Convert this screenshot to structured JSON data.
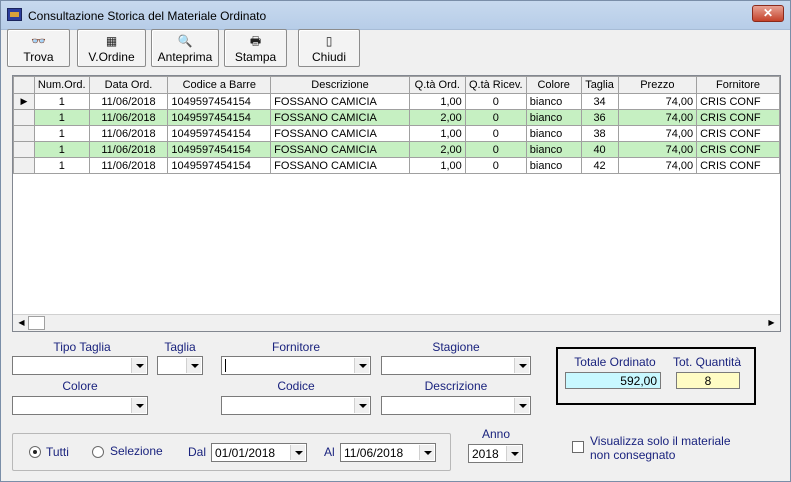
{
  "window": {
    "title": "Consultazione Storica del Materiale Ordinato",
    "close_glyph": "✕"
  },
  "toolbar": [
    {
      "name": "trova-button",
      "icon": "binoculars-icon",
      "glyph": "👓",
      "label": "Trova"
    },
    {
      "name": "vordine-button",
      "icon": "table-icon",
      "glyph": "▦",
      "label": "V.Ordine"
    },
    {
      "name": "anteprima-button",
      "icon": "preview-icon",
      "glyph": "🔍",
      "label": "Anteprima"
    },
    {
      "name": "stampa-button",
      "icon": "printer-icon",
      "glyph": "🖶",
      "label": "Stampa"
    },
    {
      "name": "chiudi-button",
      "icon": "door-icon",
      "glyph": "▯",
      "label": "Chiudi"
    }
  ],
  "grid": {
    "columns": [
      "Num.Ord.",
      "Data Ord.",
      "Codice a Barre",
      "Descrizione",
      "Q.tà Ord.",
      "Q.tà Ricev.",
      "Colore",
      "Taglia",
      "Prezzo",
      "Fornitore"
    ],
    "rows": [
      [
        "1",
        "11/06/2018",
        "1049597454154",
        "FOSSANO CAMICIA",
        "1,00",
        "0",
        "bianco",
        "34",
        "74,00",
        "CRIS CONF"
      ],
      [
        "1",
        "11/06/2018",
        "1049597454154",
        "FOSSANO CAMICIA",
        "2,00",
        "0",
        "bianco",
        "36",
        "74,00",
        "CRIS CONF"
      ],
      [
        "1",
        "11/06/2018",
        "1049597454154",
        "FOSSANO CAMICIA",
        "1,00",
        "0",
        "bianco",
        "38",
        "74,00",
        "CRIS CONF"
      ],
      [
        "1",
        "11/06/2018",
        "1049597454154",
        "FOSSANO CAMICIA",
        "2,00",
        "0",
        "bianco",
        "40",
        "74,00",
        "CRIS CONF"
      ],
      [
        "1",
        "11/06/2018",
        "1049597454154",
        "FOSSANO CAMICIA",
        "1,00",
        "0",
        "bianco",
        "42",
        "74,00",
        "CRIS CONF"
      ]
    ],
    "current_row_marker": "▶",
    "row_highlight_color": "#c6f0c2",
    "scroll_left": "◀",
    "scroll_right": "▶"
  },
  "filters": {
    "tipo_taglia": {
      "label": "Tipo Taglia",
      "value": ""
    },
    "taglia": {
      "label": "Taglia",
      "value": ""
    },
    "fornitore": {
      "label": "Fornitore",
      "value": ""
    },
    "stagione": {
      "label": "Stagione",
      "value": ""
    },
    "colore": {
      "label": "Colore",
      "value": ""
    },
    "codice": {
      "label": "Codice",
      "value": ""
    },
    "descrizione": {
      "label": "Descrizione",
      "value": ""
    }
  },
  "totals": {
    "totale_ordinato_label": "Totale Ordinato",
    "totale_ordinato_value": "592,00",
    "tot_quantita_label": "Tot. Quantità",
    "tot_quantita_value": "8",
    "totale_color": "#c8f8ff",
    "quantita_color": "#fffcc4"
  },
  "period": {
    "tutti_label": "Tutti",
    "selezione_label": "Selezione",
    "selected": "tutti",
    "dal_label": "Dal",
    "dal_value": "01/01/2018",
    "al_label": "Al",
    "al_value": "11/06/2018",
    "anno_label": "Anno",
    "anno_value": "2018"
  },
  "options": {
    "non_consegnato_label_1": "Visualizza solo il materiale",
    "non_consegnato_label_2": "non consegnato",
    "non_consegnato_checked": false
  }
}
